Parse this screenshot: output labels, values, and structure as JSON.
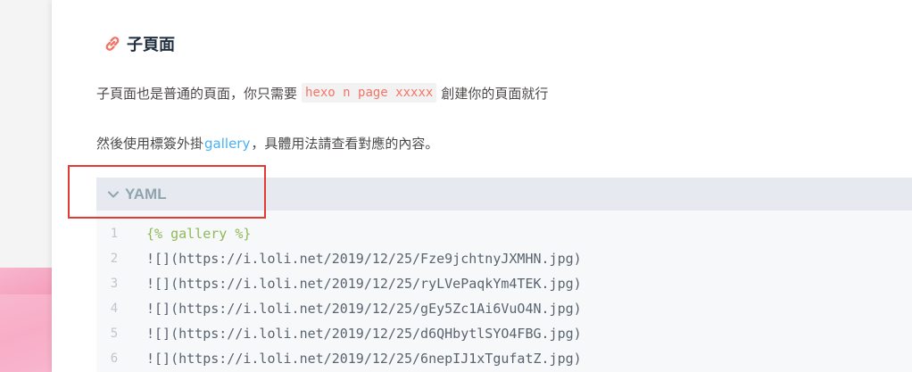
{
  "heading": {
    "title": "子頁面",
    "icon": "link-icon"
  },
  "paragraph1": {
    "before": "子頁面也是普通的頁面，你只需要",
    "code": "hexo n page xxxxx",
    "after": "創建你的頁面就行"
  },
  "paragraph2": {
    "before": "然後使用標簽外掛",
    "link": "gallery",
    "after": "，具體用法請查看對應的內容。"
  },
  "code_block": {
    "language": "YAML",
    "lines": [
      {
        "num": "1",
        "tag_open": "{%",
        "tag_name": " gallery ",
        "tag_close": "%}"
      },
      {
        "num": "2",
        "text": "![](https://i.loli.net/2019/12/25/Fze9jchtnyJXMHN.jpg)"
      },
      {
        "num": "3",
        "text": "![](https://i.loli.net/2019/12/25/ryLVePaqkYm4TEK.jpg)"
      },
      {
        "num": "4",
        "text": "![](https://i.loli.net/2019/12/25/gEy5Zc1Ai6VuO4N.jpg)"
      },
      {
        "num": "5",
        "text": "![](https://i.loli.net/2019/12/25/d6QHbytlSYO4FBG.jpg)"
      },
      {
        "num": "6",
        "text": "![](https://i.loli.net/2019/12/25/6nepIJ1xTgufatZ.jpg)"
      }
    ]
  },
  "colors": {
    "accent_link": "#49b1f5",
    "inline_code": "#f47466",
    "highlight_box": "#e53935"
  }
}
